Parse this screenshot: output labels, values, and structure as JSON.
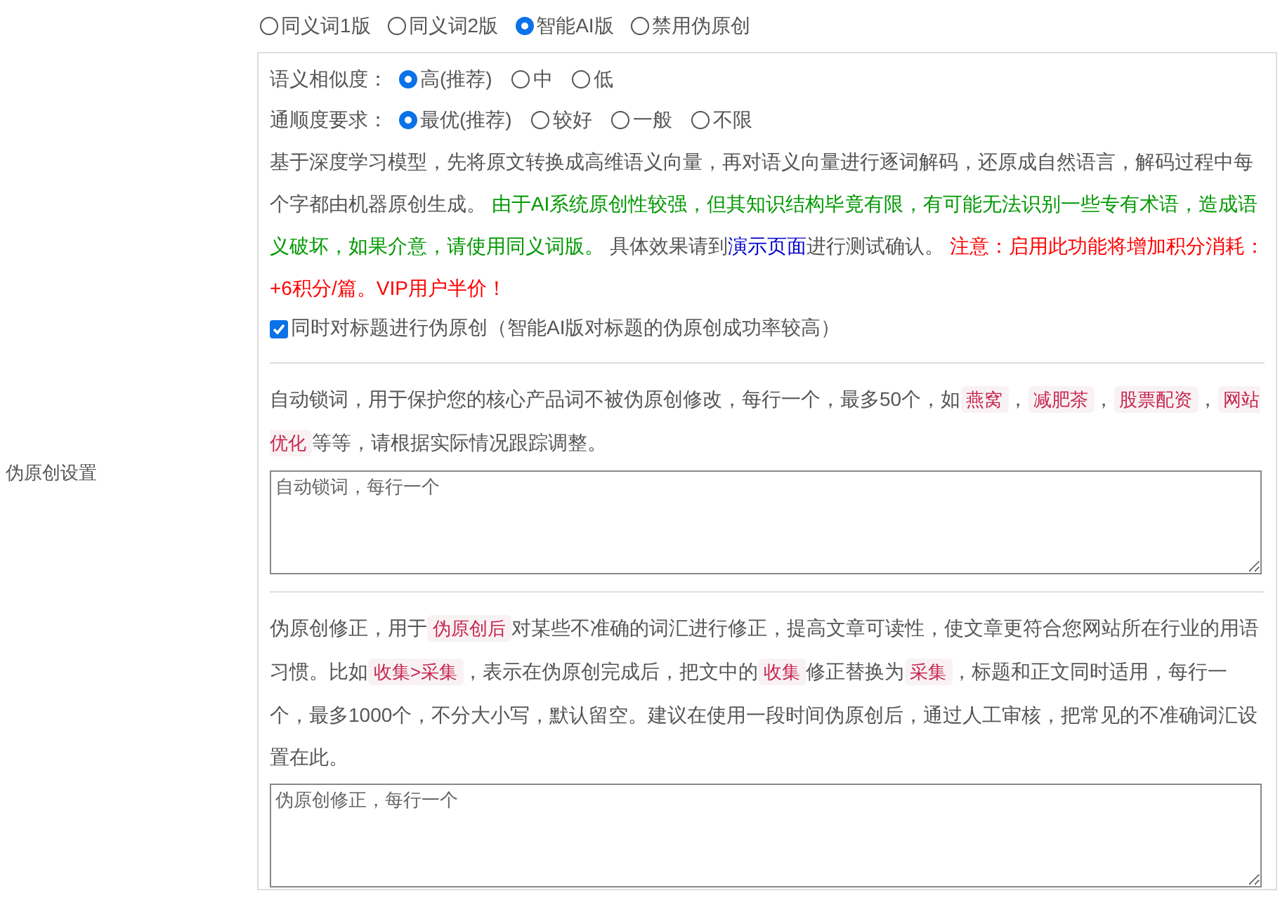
{
  "mode_options": [
    {
      "label": "同义词1版",
      "selected": false
    },
    {
      "label": "同义词2版",
      "selected": false
    },
    {
      "label": "智能AI版",
      "selected": true
    },
    {
      "label": "禁用伪原创",
      "selected": false
    }
  ],
  "ai_settings": {
    "similarity": {
      "label": "语义相似度：",
      "options": [
        {
          "label": "高(推荐)",
          "selected": true
        },
        {
          "label": "中",
          "selected": false
        },
        {
          "label": "低",
          "selected": false
        }
      ]
    },
    "fluency": {
      "label": "通顺度要求：",
      "options": [
        {
          "label": "最优(推荐)",
          "selected": true
        },
        {
          "label": "较好",
          "selected": false
        },
        {
          "label": "一般",
          "selected": false
        },
        {
          "label": "不限",
          "selected": false
        }
      ]
    },
    "description": [
      {
        "kind": "plain",
        "text": "基于深度学习模型，先将原文转换成高维语义向量，再对语义向量进行逐词解码，还原成自然语言，解码过程中每个字都由机器原创生成。 "
      },
      {
        "kind": "notice",
        "text": "由于AI系统原创性较强，但其知识结构毕竟有限，有可能无法识别一些专有术语，造成语义破坏，如果介意，请使用同义词版。"
      },
      {
        "kind": "plain",
        "text": " 具体效果请到"
      },
      {
        "kind": "link",
        "text": "演示页面"
      },
      {
        "kind": "plain",
        "text": "进行测试确认。 "
      },
      {
        "kind": "warning",
        "text": "注意：启用此功能将增加积分消耗：+6积分/篇。VIP用户半价！"
      }
    ],
    "title_option": {
      "label": "同时对标题进行伪原创（智能AI版对标题的伪原创成功率较高）",
      "checked": true
    }
  },
  "section_label": "伪原创设置",
  "lock_words": {
    "description": [
      {
        "kind": "plain",
        "text": "自动锁词，用于保护您的核心产品词不被伪原创修改，每行一个，最多50个，如"
      },
      {
        "kind": "code",
        "text": "燕窝"
      },
      {
        "kind": "plain",
        "text": "，"
      },
      {
        "kind": "code",
        "text": "减肥茶"
      },
      {
        "kind": "plain",
        "text": "，"
      },
      {
        "kind": "code",
        "text": "股票配资"
      },
      {
        "kind": "plain",
        "text": "，"
      },
      {
        "kind": "code",
        "text": "网站优化"
      },
      {
        "kind": "plain",
        "text": "等等，请根据实际情况跟踪调整。"
      }
    ],
    "placeholder": "自动锁词，每行一个"
  },
  "corrections": {
    "description": [
      {
        "kind": "plain",
        "text": "伪原创修正，用于"
      },
      {
        "kind": "code",
        "text": "伪原创后"
      },
      {
        "kind": "plain",
        "text": "对某些不准确的词汇进行修正，提高文章可读性，使文章更符合您网站所在行业的用语习惯。比如"
      },
      {
        "kind": "code",
        "text": "收集>采集"
      },
      {
        "kind": "plain",
        "text": "，表示在伪原创完成后，把文中的"
      },
      {
        "kind": "code",
        "text": "收集"
      },
      {
        "kind": "plain",
        "text": "修正替换为"
      },
      {
        "kind": "code",
        "text": "采集"
      },
      {
        "kind": "plain",
        "text": "，标题和正文同时适用，每行一个，最多1000个，不分大小写，默认留空。建议在使用一段时间伪原创后，通过人工审核，把常见的不准确词汇设置在此。"
      }
    ],
    "placeholder": "伪原创修正，每行一个"
  }
}
